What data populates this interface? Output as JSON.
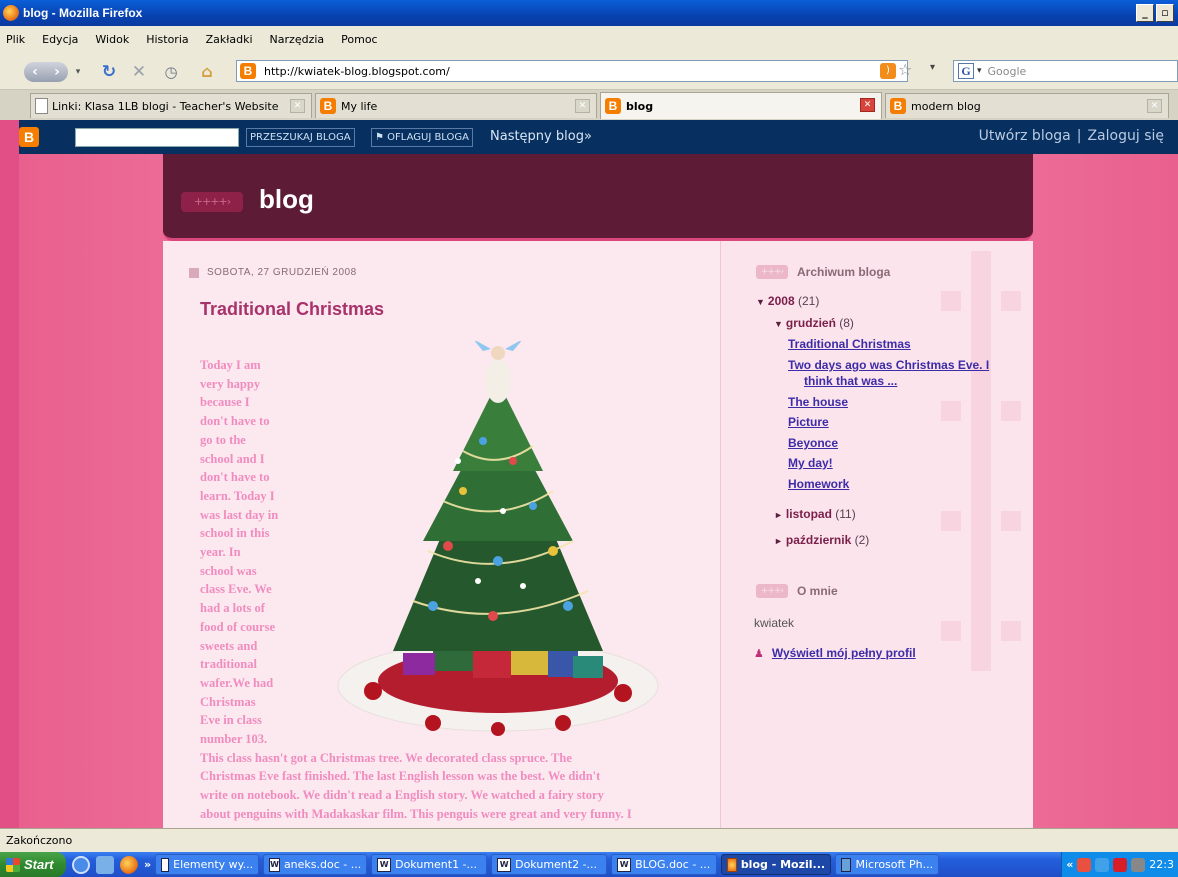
{
  "window": {
    "title": "blog - Mozilla Firefox"
  },
  "menu": [
    "Plik",
    "Edycja",
    "Widok",
    "Historia",
    "Zakładki",
    "Narzędzia",
    "Pomoc"
  ],
  "address": {
    "url": "http://kwiatek-blog.blogspot.com/"
  },
  "search": {
    "placeholder": "Google"
  },
  "tabs": [
    {
      "label": "Linki: Klasa 1LB blogi - Teacher's Website",
      "active": false
    },
    {
      "label": "My life",
      "active": false
    },
    {
      "label": "blog",
      "active": true
    },
    {
      "label": "modern blog",
      "active": false
    }
  ],
  "navbar": {
    "search_button": "PRZESZUKAJ BLOGA",
    "flag_button": "OFLAGUJ BLOGA",
    "next_blog": "Następny blog»",
    "create_blog": "Utwórz bloga",
    "separator": "|",
    "login": "Zaloguj się"
  },
  "blog": {
    "title": "blog",
    "post": {
      "date": "SOBOTA, 27 GRUDZIEŃ 2008",
      "title": "Traditional Christmas",
      "text_narrow": [
        "Today I am",
        "very happy",
        "because I",
        "don't have to",
        "go to the",
        "school and I",
        "don't have to",
        "learn. Today I",
        "was last day in",
        "school in this",
        "year. In",
        "school was",
        "class Eve. We",
        "had a lots of",
        "food of course",
        "sweets and",
        "traditional",
        "wafer.We had",
        "Christmas",
        "Eve in class",
        "number 103."
      ],
      "text_wide": [
        "This class hasn't got a Christmas tree. We decorated class spruce. The",
        "Christmas Eve fast finished. The last English lesson was the best. We didn't",
        "write on notebook. We didn't read a English story. We watched a fairy story",
        "about penguins with Madakaskar film. This penguis were great and very funny. I"
      ]
    }
  },
  "sidebar": {
    "archive_heading": "Archiwum bloga",
    "year": {
      "label": "2008",
      "count": "(21)"
    },
    "month_open": {
      "label": "grudzień",
      "count": "(8)"
    },
    "posts": [
      [
        "Traditional Christmas"
      ],
      [
        "Two days ago was Christmas Eve. I",
        "think that was ..."
      ],
      [
        "The house"
      ],
      [
        "Picture"
      ],
      [
        "Beyonce"
      ],
      [
        "My day!"
      ],
      [
        "Homework"
      ]
    ],
    "month_closed_1": {
      "label": "listopad",
      "count": "(11)"
    },
    "month_closed_2": {
      "label": "październik",
      "count": "(2)"
    },
    "about_heading": "O mnie",
    "author": "kwiatek",
    "profile_link": "Wyświetl mój pełny profil"
  },
  "status": {
    "text": "Zakończono"
  },
  "taskbar": {
    "start": "Start",
    "overflow": "»",
    "buttons": [
      {
        "label": "Elementy wy...",
        "active": false
      },
      {
        "label": "aneks.doc - ...",
        "active": false
      },
      {
        "label": "Dokument1 -...",
        "active": false
      },
      {
        "label": "Dokument2 -...",
        "active": false
      },
      {
        "label": "BLOG.doc - ...",
        "active": false
      },
      {
        "label": "blog - Mozil...",
        "active": true
      },
      {
        "label": "Microsoft Ph...",
        "active": false
      }
    ],
    "tray_chevron": "«",
    "clock": "22:3"
  }
}
